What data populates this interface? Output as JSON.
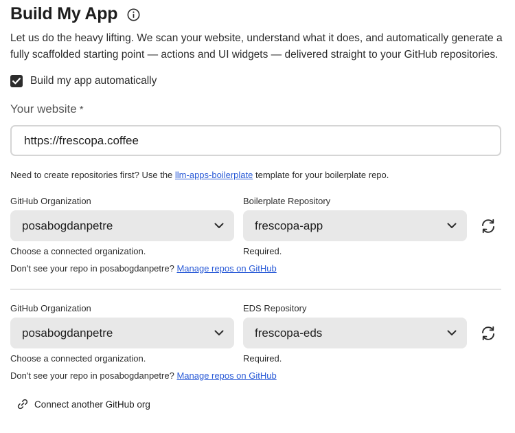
{
  "header": {
    "title": "Build My App",
    "info_icon": "info-circle-icon"
  },
  "description": "Let us do the heavy lifting. We scan your website, understand what it does, and automatically generate a fully scaffolded starting point — actions and UI widgets — delivered straight to your GitHub repositories.",
  "auto_build": {
    "label": "Build my app automatically",
    "checked": true
  },
  "website": {
    "label": "Your website",
    "required_mark": "*",
    "value": "https://frescopa.coffee"
  },
  "boilerplate_hint": {
    "prefix": "Need to create repositories first? Use the",
    "link": "llm-apps-boilerplate",
    "suffix": "template for your boilerplate repo."
  },
  "section1": {
    "org_label": "GitHub Organization",
    "org_value": "posabogdanpetre",
    "org_help": "Choose a connected organization.",
    "repo_label": "Boilerplate Repository",
    "repo_value": "frescopa-app",
    "repo_help": "Required.",
    "missing_text": "Don't see your repo in posabogdanpetre?",
    "manage_link": "Manage repos on GitHub"
  },
  "section2": {
    "org_label": "GitHub Organization",
    "org_value": "posabogdanpetre",
    "org_help": "Choose a connected organization.",
    "repo_label": "EDS Repository",
    "repo_value": "frescopa-eds",
    "repo_help": "Required.",
    "missing_text": "Don't see your repo in posabogdanpetre?",
    "manage_link": "Manage repos on GitHub"
  },
  "connect": {
    "label": "Connect another GitHub org",
    "icon": "link-icon"
  }
}
